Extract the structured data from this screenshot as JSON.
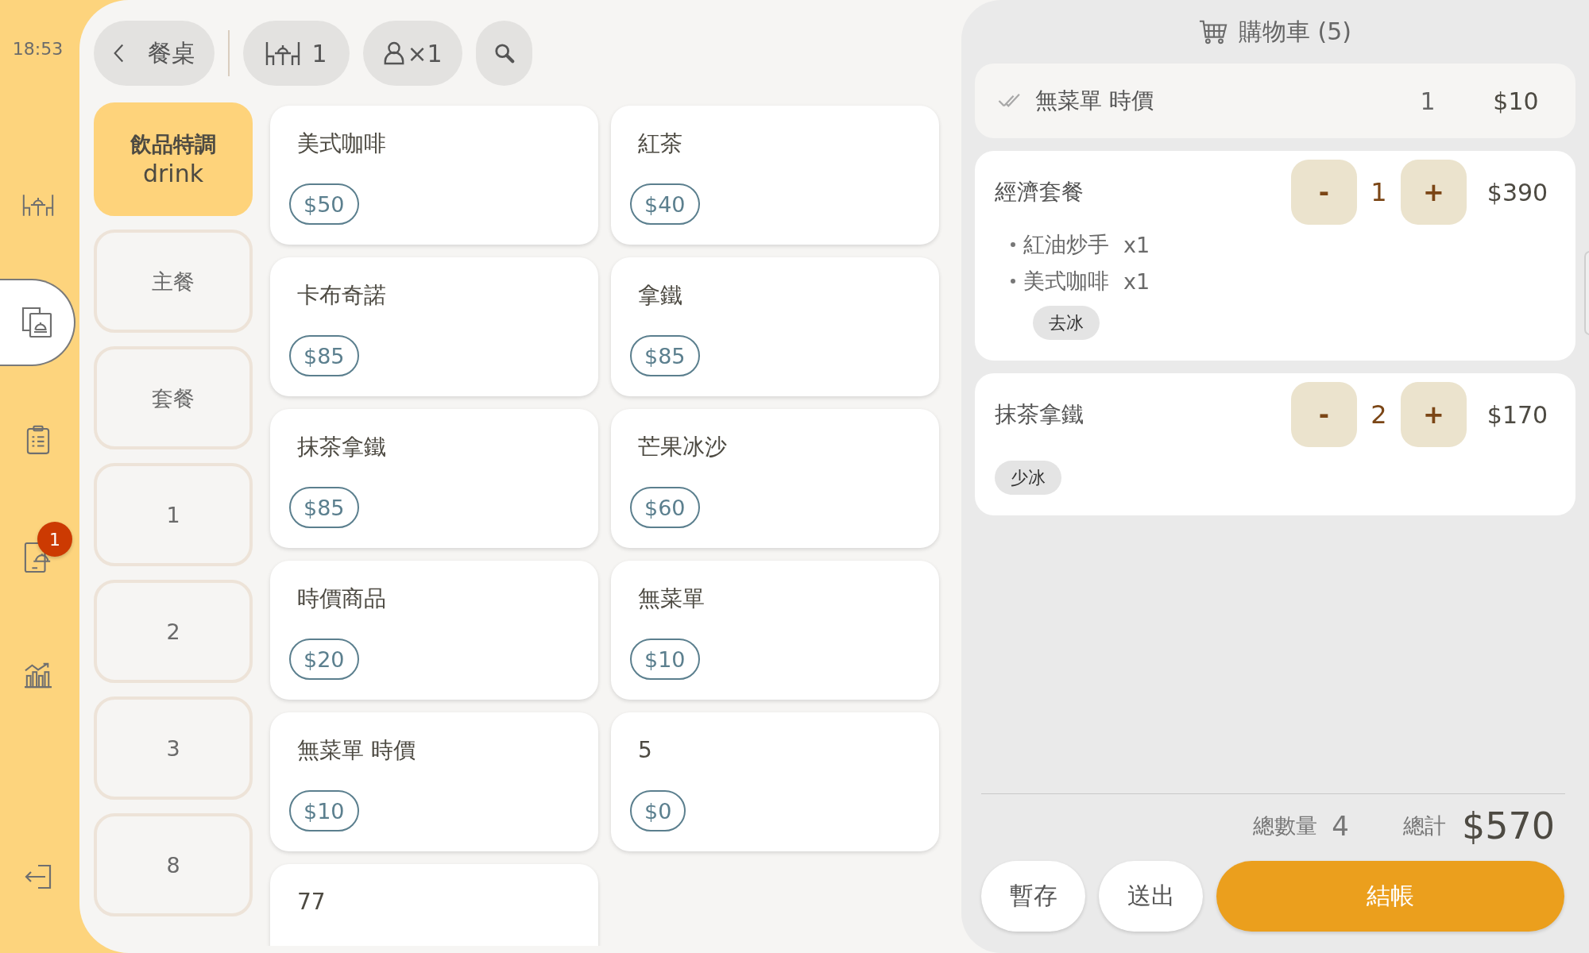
{
  "rail": {
    "time": "18:53",
    "items": [
      {
        "kind": "tables",
        "selected": false
      },
      {
        "kind": "menu",
        "selected": true
      },
      {
        "kind": "orders",
        "selected": false
      },
      {
        "kind": "online_orders",
        "selected": false,
        "badge": "1"
      },
      {
        "kind": "reports",
        "selected": false
      }
    ]
  },
  "toolbar": {
    "back": {
      "label": "餐桌"
    },
    "table": {
      "label": "1"
    },
    "guests": {
      "label": "×1"
    }
  },
  "categories": [
    {
      "label": "飲品特調",
      "sublabel": "drink",
      "selected": true
    },
    {
      "label": "主餐",
      "selected": false
    },
    {
      "label": "套餐",
      "selected": false
    },
    {
      "label": "1",
      "selected": false
    },
    {
      "label": "2",
      "selected": false
    },
    {
      "label": "3",
      "selected": false
    },
    {
      "label": "8",
      "selected": false
    }
  ],
  "products": [
    {
      "name": "美式咖啡",
      "price": "$50"
    },
    {
      "name": "紅茶",
      "price": "$40"
    },
    {
      "name": "卡布奇諾",
      "price": "$85"
    },
    {
      "name": "拿鐵",
      "price": "$85"
    },
    {
      "name": "抹茶拿鐵",
      "price": "$85"
    },
    {
      "name": "芒果冰沙",
      "price": "$60"
    },
    {
      "name": "時價商品",
      "price": "$20"
    },
    {
      "name": "無菜單",
      "price": "$10"
    },
    {
      "name": "無菜單 時價",
      "price": "$10"
    },
    {
      "name": "5",
      "price": "$0"
    },
    {
      "name": "77"
    }
  ],
  "cart": {
    "title": "購物車 (5)",
    "items": [
      {
        "kind": "sent",
        "name": "無菜單 時價",
        "qty": "1",
        "price": "$10"
      },
      {
        "kind": "pending",
        "name": "經濟套餐",
        "decrease": "-",
        "qty": "1",
        "increase": "+",
        "price": "$390",
        "components": [
          {
            "name": "紅油炒手",
            "qty": "x1"
          },
          {
            "name": "美式咖啡",
            "qty": "x1",
            "notes": [
              "去冰"
            ]
          }
        ]
      },
      {
        "kind": "pending",
        "name": "抹茶拿鐵",
        "decrease": "-",
        "qty": "2",
        "increase": "+",
        "price": "$170",
        "notes": [
          "少冰"
        ]
      }
    ],
    "summary": {
      "count_label": "總數量",
      "count": "4",
      "total_label": "總計",
      "total": "$570"
    },
    "actions": [
      {
        "label": "暫存",
        "kind": "secondary"
      },
      {
        "label": "送出",
        "kind": "secondary"
      },
      {
        "label": "結帳",
        "kind": "primary"
      }
    ]
  }
}
